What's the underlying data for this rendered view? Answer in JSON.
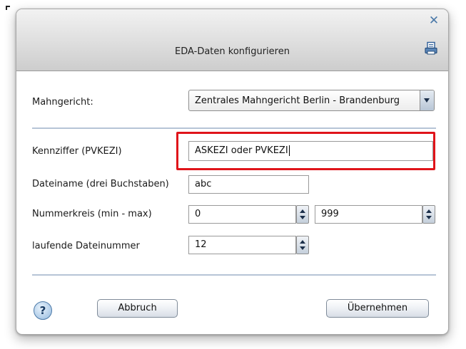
{
  "dialog": {
    "title": "EDA-Daten konfigurieren",
    "close_icon": "close-icon",
    "print_icon": "printer-icon"
  },
  "form": {
    "mahngericht": {
      "label": "Mahngericht:",
      "value": "Zentrales Mahngericht Berlin - Brandenburg"
    },
    "kennziffer": {
      "label": "Kennziffer (PVKEZI)",
      "value": "ASKEZI oder PVKEZI"
    },
    "dateiname": {
      "label": "Dateiname (drei Buchstaben)",
      "value": "abc"
    },
    "nummerkreis": {
      "label": "Nummerkreis (min - max)",
      "min": "0",
      "max": "999"
    },
    "laufende_dateinummer": {
      "label": "laufende Dateinummer",
      "value": "12"
    }
  },
  "footer": {
    "help_label": "?",
    "cancel_label": "Abbruch",
    "apply_label": "Übernehmen"
  },
  "colors": {
    "highlight": "#e0141a",
    "separator": "#b6c4d6",
    "accent": "#4a78a8"
  }
}
